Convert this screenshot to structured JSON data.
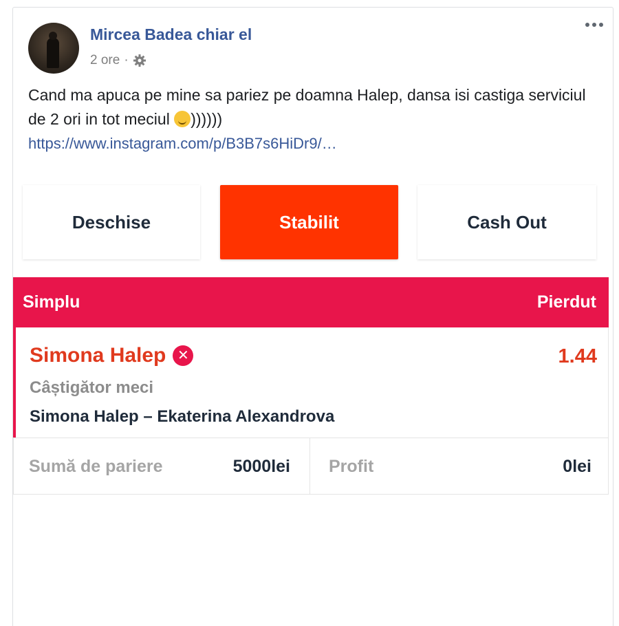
{
  "post": {
    "author": "Mircea Badea chiar el",
    "time": "2 ore",
    "time_separator": "·",
    "text_part1": "Cand ma apuca pe mine sa pariez pe doamna Halep, dansa isi castiga serviciul de 2 ori in tot meciul ",
    "text_part2": "))))))",
    "link": "https://www.instagram.com/p/B3B7s6HiDr9/…",
    "icons": [
      "avatar",
      "gear-icon",
      "more-options-icon",
      "smiley-emoji-icon"
    ]
  },
  "tabs": [
    {
      "label": "Deschise",
      "active": false
    },
    {
      "label": "Stabilit",
      "active": true
    },
    {
      "label": "Cash Out",
      "active": false
    }
  ],
  "bet": {
    "type": "Simplu",
    "status": "Pierdut",
    "selection": "Simona Halep",
    "odds": "1.44",
    "market": "Câștigător meci",
    "event": "Simona Halep – Ekaterina Alexandrova",
    "stake_label": "Sumă de pariere",
    "stake_value": "5000lei",
    "profit_label": "Profit",
    "profit_value": "0lei",
    "lost_icon": "x-circle-icon"
  },
  "colors": {
    "link_blue": "#385898",
    "active_tab": "#ff3300",
    "slip_header": "#e8154b",
    "selection_text": "#e03a1e"
  }
}
